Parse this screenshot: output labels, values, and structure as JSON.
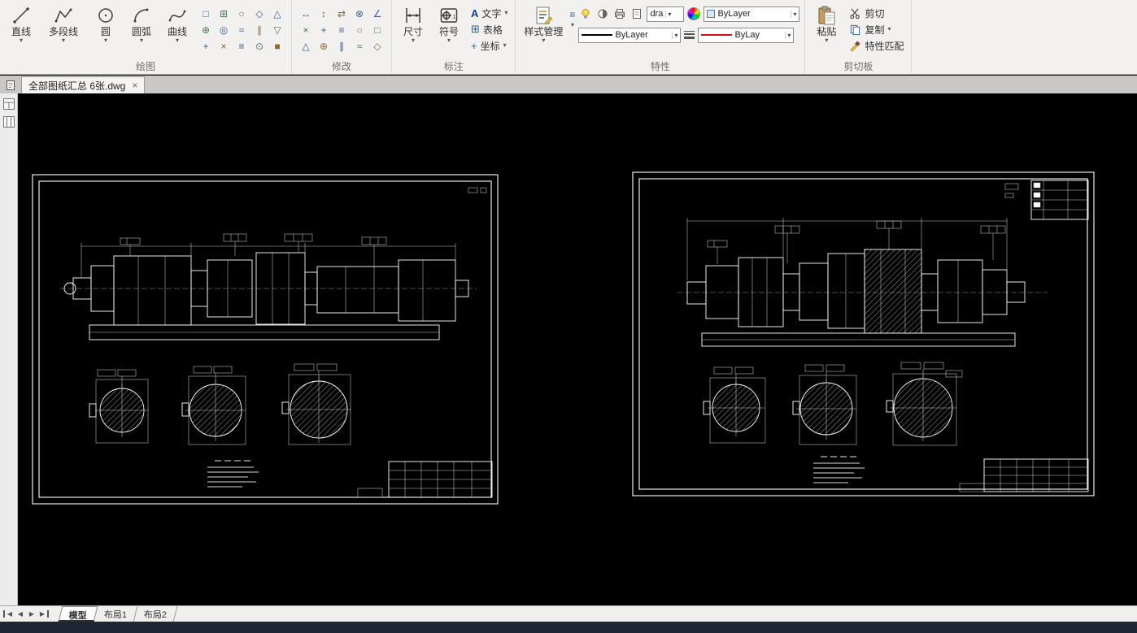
{
  "ui": {
    "caret": "▾",
    "close": "×"
  },
  "doc_tab": {
    "title": "全部图纸汇总 6张.dwg"
  },
  "ribbon": {
    "draw": {
      "label": "绘图",
      "buttons": [
        {
          "label": "直线"
        },
        {
          "label": "多段线"
        },
        {
          "label": "圆"
        },
        {
          "label": "圆弧"
        },
        {
          "label": "曲线"
        }
      ],
      "grid": [
        "□",
        "⊞",
        "○",
        "◇",
        "△",
        "⊕",
        "◎",
        "≈",
        "∥",
        "▽",
        "+",
        "×",
        "≡",
        "⊙",
        "■"
      ]
    },
    "modify": {
      "label": "修改",
      "grid": [
        "↔",
        "↕",
        "⇄",
        "⊗",
        "∠",
        "×",
        "+",
        "≡",
        "○",
        "□",
        "△",
        "⊕",
        "∥",
        "≈",
        "◇"
      ]
    },
    "annotate": {
      "label": "标注",
      "buttons": [
        {
          "label": "尺寸"
        },
        {
          "label": "符号"
        }
      ],
      "small": [
        {
          "label": "文字",
          "icon": "A"
        },
        {
          "label": "表格",
          "icon": "⊞"
        },
        {
          "label": "坐标",
          "icon": "+"
        }
      ]
    },
    "properties": {
      "label": "特性",
      "style_manager": "样式管理",
      "draw_order": "dra",
      "color": "ByLayer",
      "linetype": "ByLayer",
      "lineweight": "ByLay",
      "list_icon": "≡"
    },
    "clipboard": {
      "label": "剪切板",
      "paste": "粘贴",
      "cut": "剪切",
      "copy": "复制",
      "match": "特性匹配"
    }
  },
  "layout_tabs": {
    "nav": [
      "◀",
      "◀",
      "▶",
      "▶"
    ],
    "tabs": [
      {
        "label": "模型"
      },
      {
        "label": "布局1"
      },
      {
        "label": "布局2"
      }
    ]
  },
  "colors": {
    "canvas_bg": "#000000",
    "ribbon_bg": "#f2f1f0",
    "statusbar_bg": "#1c2733",
    "line_red": "#cc1111"
  }
}
